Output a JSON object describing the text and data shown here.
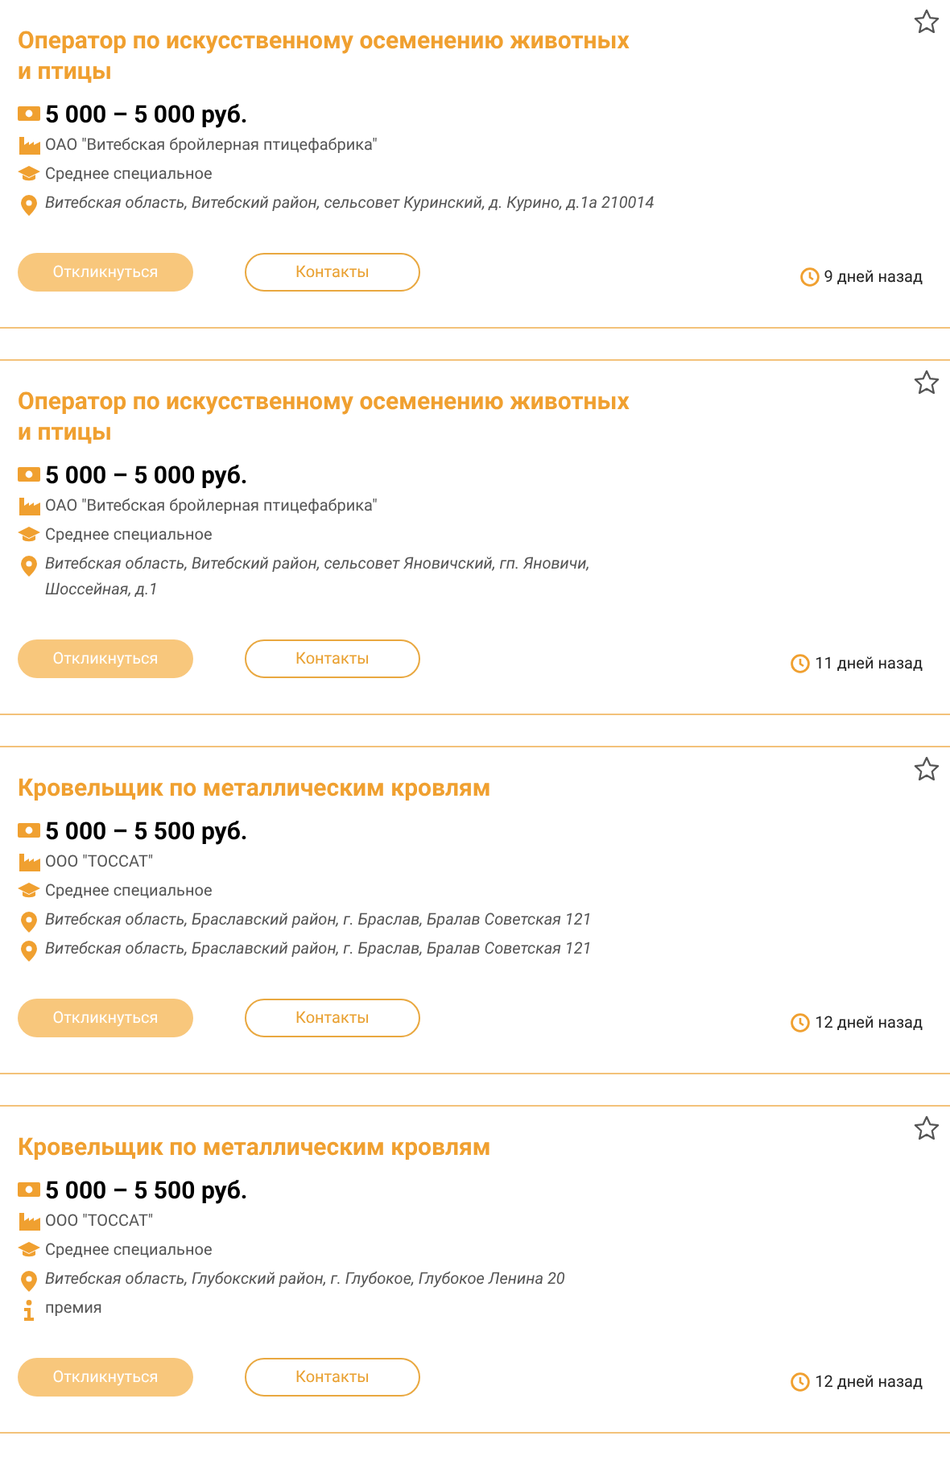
{
  "vacancies": [
    {
      "title": "Оператор по искусственному осеменению животных и птицы",
      "favorite": false,
      "details": [
        {
          "kind": "salary",
          "text": "5 000 – 5 000 руб."
        },
        {
          "kind": "company",
          "text": "ОАО \"Витебская бройлерная птицефабрика\""
        },
        {
          "kind": "education",
          "text": "Среднее специальное"
        },
        {
          "kind": "location",
          "text": "Витебская область, Витебский район, сельсовет Куринский, д. Курино, д.1а 210014"
        }
      ],
      "apply": "Откликнуться",
      "contacts": "Контакты",
      "posted": "9 дней назад"
    },
    {
      "title": "Оператор по искусственному осеменению животных и птицы",
      "favorite": false,
      "details": [
        {
          "kind": "salary",
          "text": "5 000 – 5 000 руб."
        },
        {
          "kind": "company",
          "text": "ОАО \"Витебская бройлерная птицефабрика\""
        },
        {
          "kind": "education",
          "text": "Среднее специальное"
        },
        {
          "kind": "location",
          "text": "Витебская область, Витебский район, сельсовет Яновичский, гп. Яновичи, Шоссейная, д.1"
        }
      ],
      "apply": "Откликнуться",
      "contacts": "Контакты",
      "posted": "11 дней назад"
    },
    {
      "title": "Кровельщик по металлическим кровлям",
      "favorite": false,
      "details": [
        {
          "kind": "salary",
          "text": "5 000 – 5 500 руб."
        },
        {
          "kind": "company",
          "text": "ООО \"ТОССАТ\""
        },
        {
          "kind": "education",
          "text": "Среднее специальное"
        },
        {
          "kind": "location",
          "text": "Витебская область, Браславский район, г. Браслав, Бралав Советская 121"
        },
        {
          "kind": "location",
          "text": "Витебская область, Браславский район, г. Браслав, Бралав Советская 121"
        }
      ],
      "apply": "Откликнуться",
      "contacts": "Контакты",
      "posted": "12 дней назад"
    },
    {
      "title": "Кровельщик по металлическим кровлям",
      "favorite": false,
      "details": [
        {
          "kind": "salary",
          "text": "5 000 – 5 500 руб."
        },
        {
          "kind": "company",
          "text": "ООО \"ТОССАТ\""
        },
        {
          "kind": "education",
          "text": "Среднее специальное"
        },
        {
          "kind": "location",
          "text": "Витебская область, Глубокский район, г. Глубокое, Глубокое Ленина 20"
        },
        {
          "kind": "info",
          "text": "премия"
        }
      ],
      "apply": "Откликнуться",
      "contacts": "Контакты",
      "posted": "12 дней назад"
    }
  ]
}
